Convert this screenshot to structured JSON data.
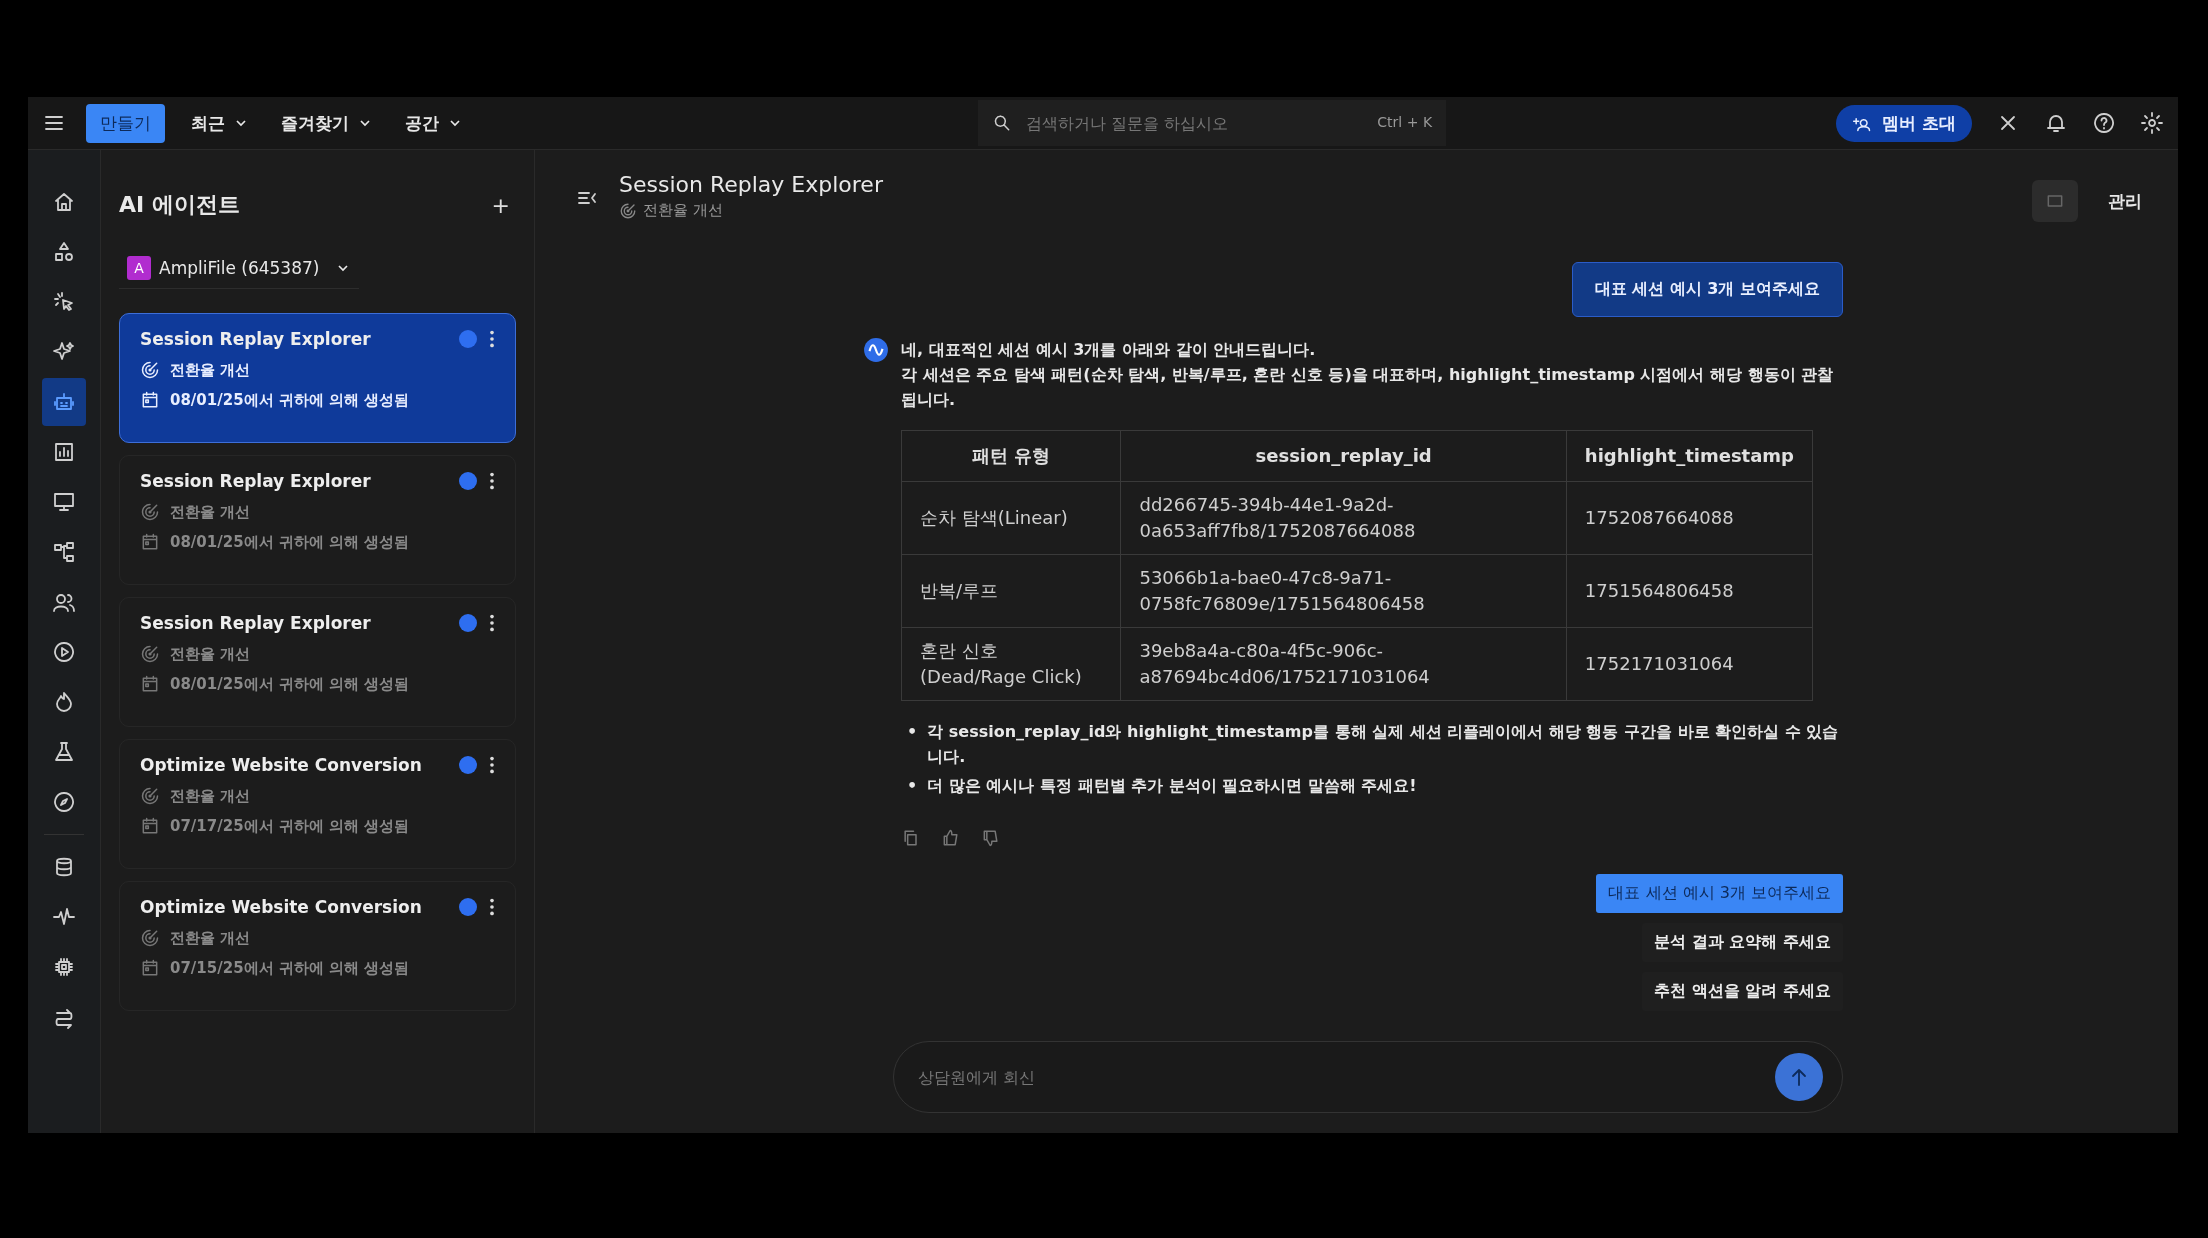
{
  "topbar": {
    "create_button": "만들기",
    "menus": [
      {
        "label": "최근"
      },
      {
        "label": "즐겨찾기"
      },
      {
        "label": "공간"
      }
    ],
    "search": {
      "placeholder": "검색하거나 질문을 하십시오",
      "shortcut": "Ctrl + K"
    },
    "invite_button": "멤버 초대"
  },
  "rail": [
    {
      "kind": "home",
      "selected": false
    },
    {
      "kind": "shapes",
      "selected": false
    },
    {
      "kind": "cursor",
      "selected": false
    },
    {
      "kind": "sparkle",
      "selected": false
    },
    {
      "kind": "robot",
      "selected": true
    },
    {
      "kind": "chart",
      "selected": false
    },
    {
      "kind": "monitor",
      "selected": false
    },
    {
      "kind": "flow",
      "selected": false
    },
    {
      "kind": "users",
      "selected": false
    },
    {
      "kind": "play",
      "selected": false
    },
    {
      "kind": "fire",
      "selected": false
    },
    {
      "kind": "flask",
      "selected": false
    },
    {
      "kind": "compass",
      "selected": false
    },
    {
      "kind": "database",
      "selected": false
    },
    {
      "kind": "pulse",
      "selected": false
    },
    {
      "kind": "chip",
      "selected": false
    },
    {
      "kind": "arrows",
      "selected": false
    }
  ],
  "agents_panel": {
    "title": "AI 에이전트",
    "add": "+",
    "workspace": {
      "initial": "A",
      "name": "AmpliFile (645387)"
    },
    "items": [
      {
        "title": "Session Replay Explorer",
        "goal": "전환율 개선",
        "created": "08/01/25에서 귀하에 의해 생성됨",
        "selected": true
      },
      {
        "title": "Session Replay Explorer",
        "goal": "전환율 개선",
        "created": "08/01/25에서 귀하에 의해 생성됨",
        "selected": false
      },
      {
        "title": "Session Replay Explorer",
        "goal": "전환율 개선",
        "created": "08/01/25에서 귀하에 의해 생성됨",
        "selected": false
      },
      {
        "title": "Optimize Website Conversion",
        "goal": "전환율 개선",
        "created": "07/17/25에서 귀하에 의해 생성됨",
        "selected": false
      },
      {
        "title": "Optimize Website Conversion",
        "goal": "전환율 개선",
        "created": "07/15/25에서 귀하에 의해 생성됨",
        "selected": false
      }
    ]
  },
  "chat": {
    "title": "Session Replay Explorer",
    "subtitle": "전환율 개선",
    "manage_button": "관리",
    "user_message": "대표 세션 예시 3개 보여주세요",
    "reply": {
      "paragraphs": [
        "네, 대표적인 세션 예시 3개를 아래와 같이 안내드립니다.",
        "각 세션은 주요 탐색 패턴(순차 탐색, 반복/루프, 혼란 신호 등)을 대표하며, highlight_timestamp 시점에서 해당 행동이 관찰됩니다."
      ],
      "table": {
        "columns": [
          "패턴 유형",
          "session_replay_id",
          "highlight_timestamp"
        ],
        "rows": [
          [
            "순차 탐색(Linear)",
            "dd266745-394b-44e1-9a2d-0a653aff7fb8/1752087664088",
            "1752087664088"
          ],
          [
            "반복/루프",
            "53066b1a-bae0-47c8-9a71-0758fc76809e/1751564806458",
            "1751564806458"
          ],
          [
            "혼란 신호 (Dead/Rage Click)",
            "39eb8a4a-c80a-4f5c-906c-a87694bc4d06/1752171031064",
            "1752171031064"
          ]
        ]
      },
      "bullets": [
        {
          "marker": "•",
          "text": "각 session_replay_id와 highlight_timestamp를 통해 실제 세션 리플레이에서 해당 행동 구간을 바로 확인하실 수 있습니다."
        },
        {
          "marker": "•",
          "text": "더 많은 예시나 특정 패턴별 추가 분석이 필요하시면 말씀해 주세요!"
        }
      ]
    },
    "suggestions": [
      {
        "label": "대표 세션 예시 3개 보여주세요",
        "selected": true
      },
      {
        "label": "분석 결과 요약해 주세요",
        "selected": false
      },
      {
        "label": "추천 액션을 알려 주세요",
        "selected": false
      }
    ],
    "input": {
      "placeholder": "상담원에게 회신"
    }
  }
}
